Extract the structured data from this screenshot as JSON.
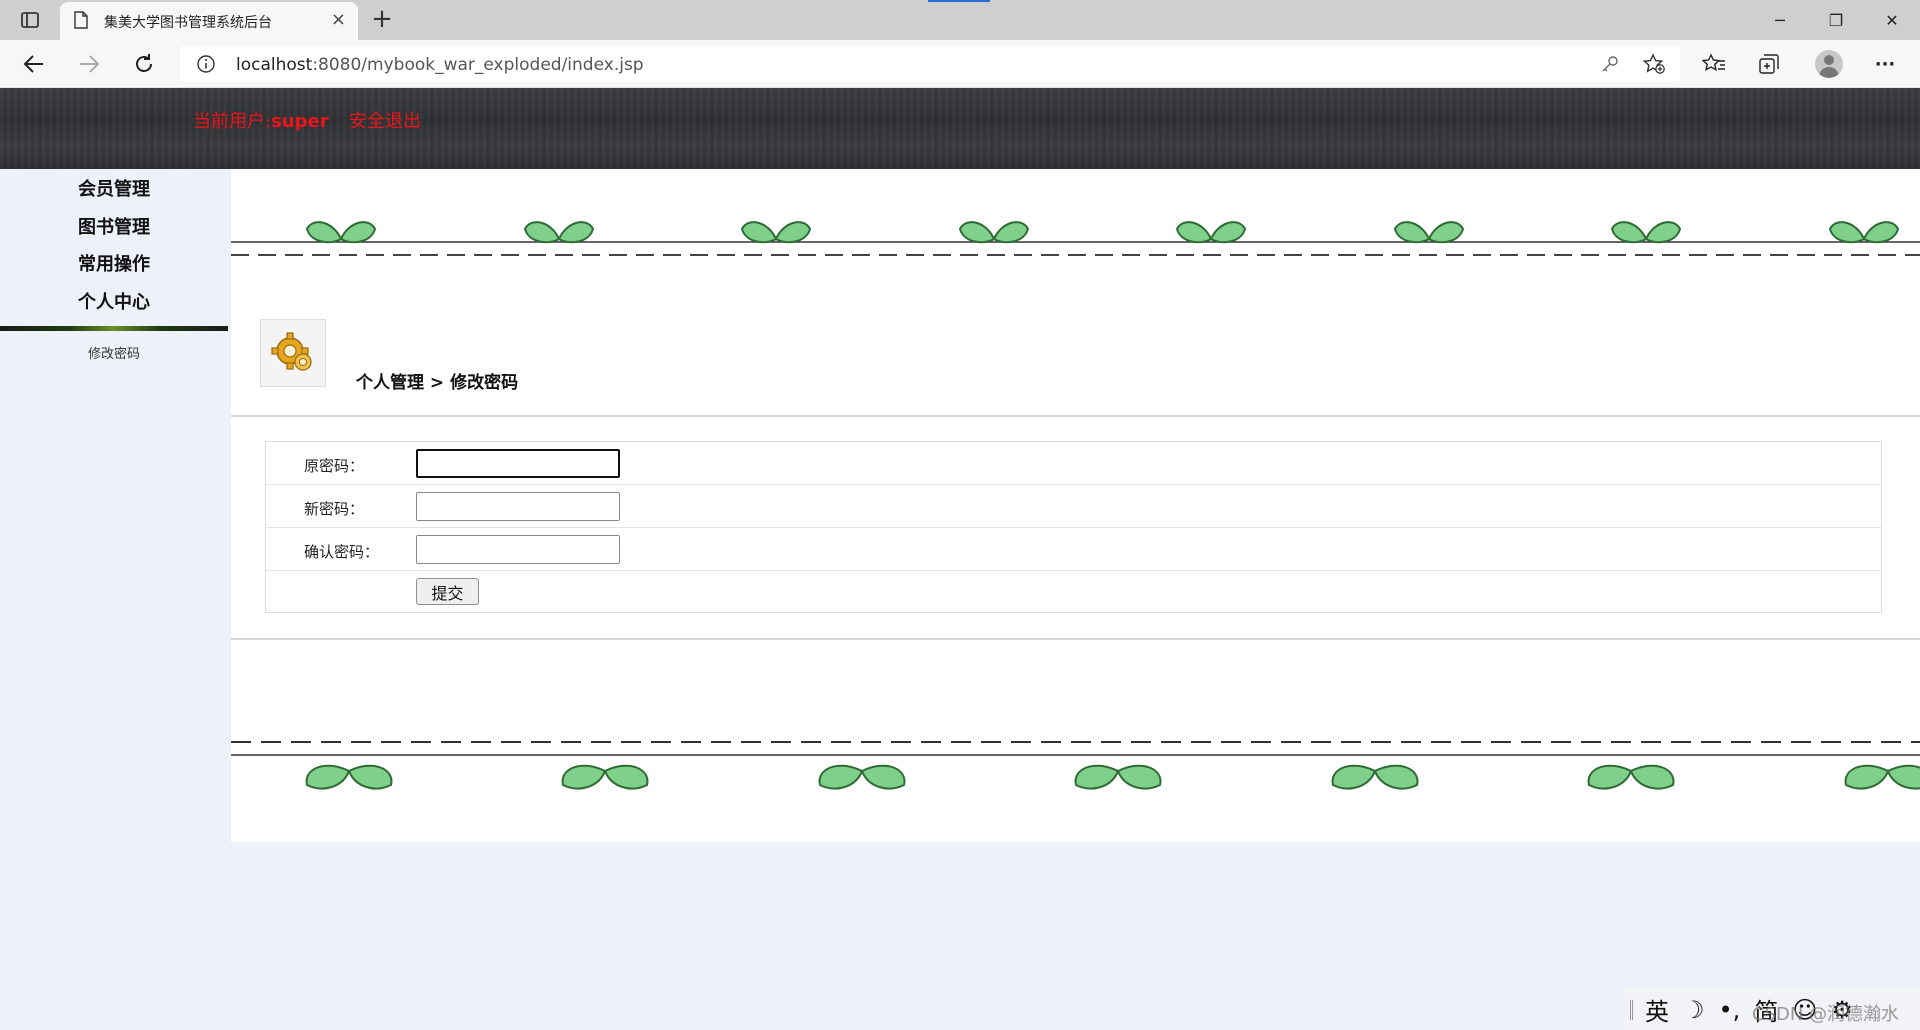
{
  "browser": {
    "tab_title": "集美大学图书管理系统后台",
    "tab_close": "×",
    "new_tab": "+",
    "url_host": "localhost",
    "url_rest": ":8080/mybook_war_exploded/index.jsp",
    "window_buttons": [
      "─",
      "❐",
      "✕"
    ],
    "more_label": "···"
  },
  "header": {
    "current_user_label": "当前用户:",
    "username": "super",
    "logout_label": "安全退出",
    "text_color": "#e8161a"
  },
  "sidebar": {
    "items": [
      {
        "label": "会员管理"
      },
      {
        "label": "图书管理"
      },
      {
        "label": "常用操作"
      },
      {
        "label": "个人中心"
      }
    ],
    "submenu": {
      "label": "修改密码"
    }
  },
  "main": {
    "breadcrumb": "个人管理 > 修改密码",
    "form": {
      "old_password_label": "原密码：",
      "new_password_label": "新密码：",
      "confirm_password_label": "确认密码：",
      "old_password_value": "",
      "new_password_value": "",
      "confirm_password_value": "",
      "submit_label": "提交"
    }
  },
  "ime": {
    "items": [
      "英",
      "☽",
      "•,",
      "简",
      "☺",
      "⚙"
    ]
  },
  "watermark": "CSDN @润德瀚水"
}
